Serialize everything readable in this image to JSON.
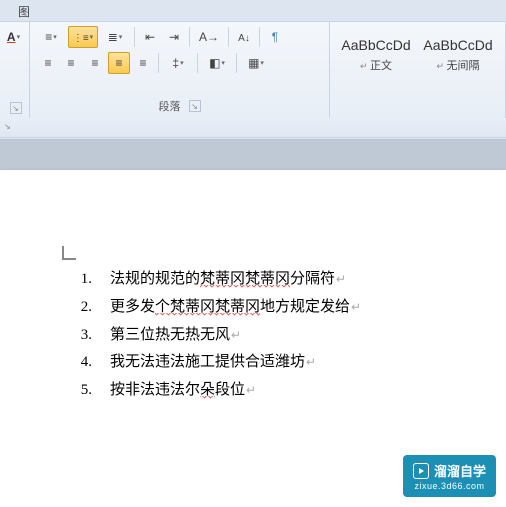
{
  "ribbon": {
    "tab": "图",
    "paragraph_group_label": "段落",
    "styles": [
      {
        "preview": "AaBbCcDd",
        "name": "正文"
      },
      {
        "preview": "AaBbCcDd",
        "name": "无间隔"
      }
    ]
  },
  "document": {
    "items": [
      {
        "num": "1.",
        "text_parts": [
          {
            "t": "法规的规范的",
            "err": false
          },
          {
            "t": "梵蒂冈梵蒂冈",
            "err": true
          },
          {
            "t": "分隔符",
            "err": false
          }
        ]
      },
      {
        "num": "2.",
        "text_parts": [
          {
            "t": "更多发",
            "err": false
          },
          {
            "t": "个梵蒂冈梵蒂冈",
            "err": true
          },
          {
            "t": "地方规定发给",
            "err": false
          }
        ]
      },
      {
        "num": "3.",
        "text_parts": [
          {
            "t": "第三位热无热无风",
            "err": false
          }
        ]
      },
      {
        "num": "4.",
        "text_parts": [
          {
            "t": "我无法违法施工提供合适潍坊",
            "err": false
          }
        ]
      },
      {
        "num": "5.",
        "text_parts": [
          {
            "t": "按非法违法尔",
            "err": false
          },
          {
            "t": "朵",
            "err": true
          },
          {
            "t": "段位",
            "err": false
          }
        ]
      }
    ]
  },
  "watermark": {
    "title": "溜溜自学",
    "url": "zixue.3d66.com"
  }
}
